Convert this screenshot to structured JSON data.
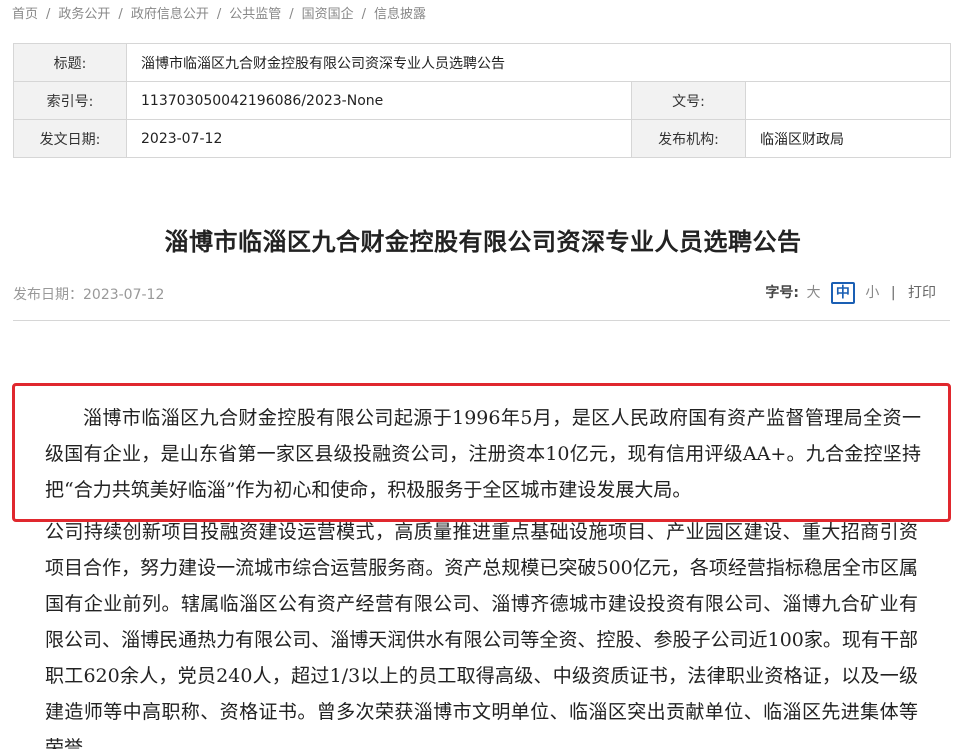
{
  "breadcrumb": {
    "items": [
      "首页",
      "政务公开",
      "政府信息公开",
      "公共监管",
      "国资国企",
      "信息披露"
    ],
    "separator": "/"
  },
  "meta": {
    "title_label": "标题:",
    "title_value": "淄博市临淄区九合财金控股有限公司资深专业人员选聘公告",
    "index_label": "索引号:",
    "index_value": "113703050042196086/2023-None",
    "doc_no_label": "文号:",
    "doc_no_value": "",
    "date_label": "发文日期:",
    "date_value": "2023-07-12",
    "org_label": "发布机构:",
    "org_value": "临淄区财政局"
  },
  "article": {
    "title": "淄博市临淄区九合财金控股有限公司资深专业人员选聘公告",
    "publish_date": "发布日期：2023-07-12",
    "font_size_label": "字号:",
    "font_size_large": "大",
    "font_size_medium": "中",
    "font_size_small": "小",
    "divider": "|",
    "print_label": "打印",
    "highlighted_paragraph": "淄博市临淄区九合财金控股有限公司起源于1996年5月，是区人民政府国有资产监督管理局全资一级国有企业，是山东省第一家区县级投融资公司，注册资本10亿元，现有信用评级AA+。九合金控坚持把“合力共筑美好临淄”作为初心和使命，积极服务于全区城市建设发展大局。",
    "body_paragraph": "公司持续创新项目投融资建设运营模式，高质量推进重点基础设施项目、产业园区建设、重大招商引资项目合作，努力建设一流城市综合运营服务商。资产总规模已突破500亿元，各项经营指标稳居全市区属国有企业前列。辖属临淄区公有资产经营有限公司、淄博齐德城市建设投资有限公司、淄博九合矿业有限公司、淄博民通热力有限公司、淄博天润供水有限公司等全资、控股、参股子公司近100家。现有干部职工620余人，党员240人，超过1/3以上的员工取得高级、中级资质证书，法律职业资格证，以及一级建造师等中高职称、资格证书。曾多次荣获淄博市文明单位、临淄区突出贡献单位、临淄区先进集体等荣誉。"
  },
  "colors": {
    "highlight_border": "#e0282e",
    "active_font_size": "#1a5fb4",
    "table_label_bg": "#f2f2f2"
  }
}
